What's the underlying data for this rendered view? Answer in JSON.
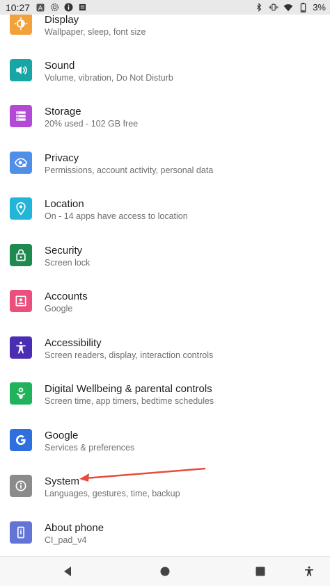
{
  "status": {
    "time": "10:27",
    "battery": "3%"
  },
  "settings": [
    {
      "title": "Display",
      "subtitle": "Wallpaper, sleep, font size",
      "color": "#f2a23a",
      "icon": "display-icon"
    },
    {
      "title": "Sound",
      "subtitle": "Volume, vibration, Do Not Disturb",
      "color": "#17a5a5",
      "icon": "sound-icon"
    },
    {
      "title": "Storage",
      "subtitle": "20% used - 102 GB free",
      "color": "#b34ad6",
      "icon": "storage-icon"
    },
    {
      "title": "Privacy",
      "subtitle": "Permissions, account activity, personal data",
      "color": "#4f8fe8",
      "icon": "privacy-icon"
    },
    {
      "title": "Location",
      "subtitle": "On - 14 apps have access to location",
      "color": "#22b5d8",
      "icon": "location-icon"
    },
    {
      "title": "Security",
      "subtitle": "Screen lock",
      "color": "#1e8a4f",
      "icon": "lock-icon"
    },
    {
      "title": "Accounts",
      "subtitle": "Google",
      "color": "#ec4f7c",
      "icon": "accounts-icon"
    },
    {
      "title": "Accessibility",
      "subtitle": "Screen readers, display, interaction controls",
      "color": "#4b2db4",
      "icon": "accessibility-icon"
    },
    {
      "title": "Digital Wellbeing & parental controls",
      "subtitle": "Screen time, app timers, bedtime schedules",
      "color": "#20b35b",
      "icon": "wellbeing-icon"
    },
    {
      "title": "Google",
      "subtitle": "Services & preferences",
      "color": "#2f6fe0",
      "icon": "google-icon"
    },
    {
      "title": "System",
      "subtitle": "Languages, gestures, time, backup",
      "color": "#8b8b8b",
      "icon": "info-icon"
    },
    {
      "title": "About phone",
      "subtitle": "CI_pad_v4",
      "color": "#6274d6",
      "icon": "phone-icon"
    }
  ],
  "annotation": {
    "color": "#e74c3c"
  }
}
